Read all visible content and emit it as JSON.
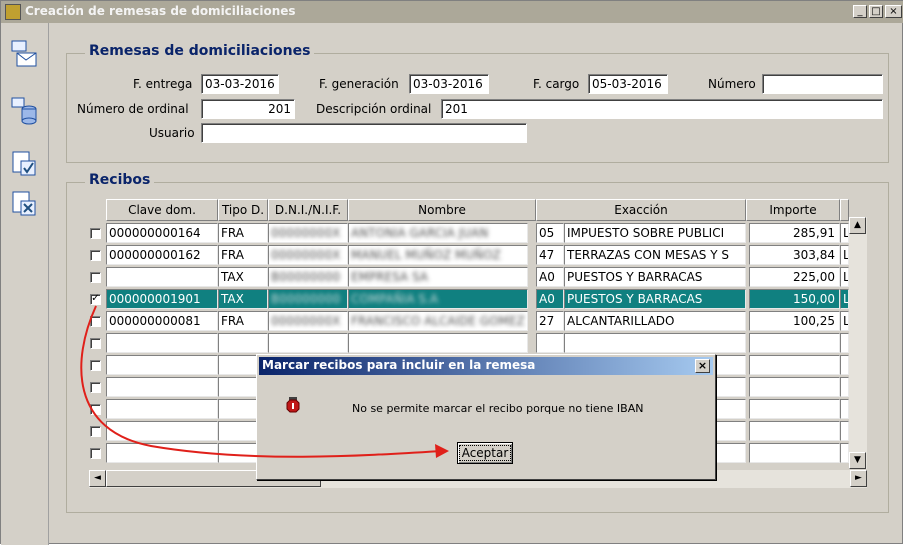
{
  "window": {
    "title": "Creación de remesas de domiciliaciones",
    "min_label": "_",
    "max_label": "□",
    "close_label": "×"
  },
  "toolbar": {
    "buttons": [
      "envelope-icon",
      "database-icon",
      "check-document-icon",
      "cancel-document-icon"
    ]
  },
  "remesas": {
    "legend": "Remesas de domiciliaciones",
    "f_entrega_label": "F. entrega",
    "f_entrega": "03-03-2016",
    "f_generacion_label": "F. generación",
    "f_generacion": "03-03-2016",
    "f_cargo_label": "F. cargo",
    "f_cargo": "05-03-2016",
    "numero_label": "Número",
    "numero": "",
    "num_ordinal_label": "Número de ordinal",
    "num_ordinal": "201",
    "desc_ordinal_label": "Descripción ordinal",
    "desc_ordinal": "201",
    "usuario_label": "Usuario",
    "usuario": ""
  },
  "recibos": {
    "legend": "Recibos",
    "columns": [
      "Clave dom.",
      "Tipo D.",
      "D.N.I./N.I.F.",
      "Nombre",
      "Exacción",
      "Importe",
      ""
    ],
    "rows": [
      {
        "checked": "",
        "clave": "000000000164",
        "tipo": "FRA",
        "dni": "00000000X",
        "nombre": "ANTONIA GARCIA JUAN",
        "exc_code": "05",
        "exaccion": "IMPUESTO SOBRE PUBLICI",
        "importe": "285,91",
        "extra": "Liq:"
      },
      {
        "checked": "",
        "clave": "000000000162",
        "tipo": "FRA",
        "dni": "00000000X",
        "nombre": "MANUEL MUÑOZ MUÑOZ",
        "exc_code": "47",
        "exaccion": "TERRAZAS CON MESAS Y S",
        "importe": "303,84",
        "extra": "Liq:"
      },
      {
        "checked": "",
        "clave": "",
        "tipo": "TAX",
        "dni": "B00000000",
        "nombre": "EMPRESA SA",
        "exc_code": "A0",
        "exaccion": "PUESTOS Y BARRACAS",
        "importe": "225,00",
        "extra": "Liq:"
      },
      {
        "checked": "✓",
        "clave": "000000001901",
        "tipo": "TAX",
        "dni": "B00000000",
        "nombre": "COMPAÑIA S.A",
        "exc_code": "A0",
        "exaccion": "PUESTOS Y BARRACAS",
        "importe": "150,00",
        "extra": "Liq:"
      },
      {
        "checked": "",
        "clave": "000000000081",
        "tipo": "FRA",
        "dni": "00000000X",
        "nombre": "FRANCISCO ALCAIDE GOMEZ",
        "exc_code": "27",
        "exaccion": "ALCANTARILLADO",
        "importe": "100,25",
        "extra": "Liq:"
      }
    ]
  },
  "dialog": {
    "title": "Marcar recibos para incluir en la remesa",
    "message": "No se permite marcar el recibo porque no tiene IBAN",
    "ok_label": "Aceptar",
    "close_label": "×"
  },
  "colors": {
    "selection": "#108080",
    "arrow": "#e0201a",
    "dialog_title": "#0a246a"
  }
}
